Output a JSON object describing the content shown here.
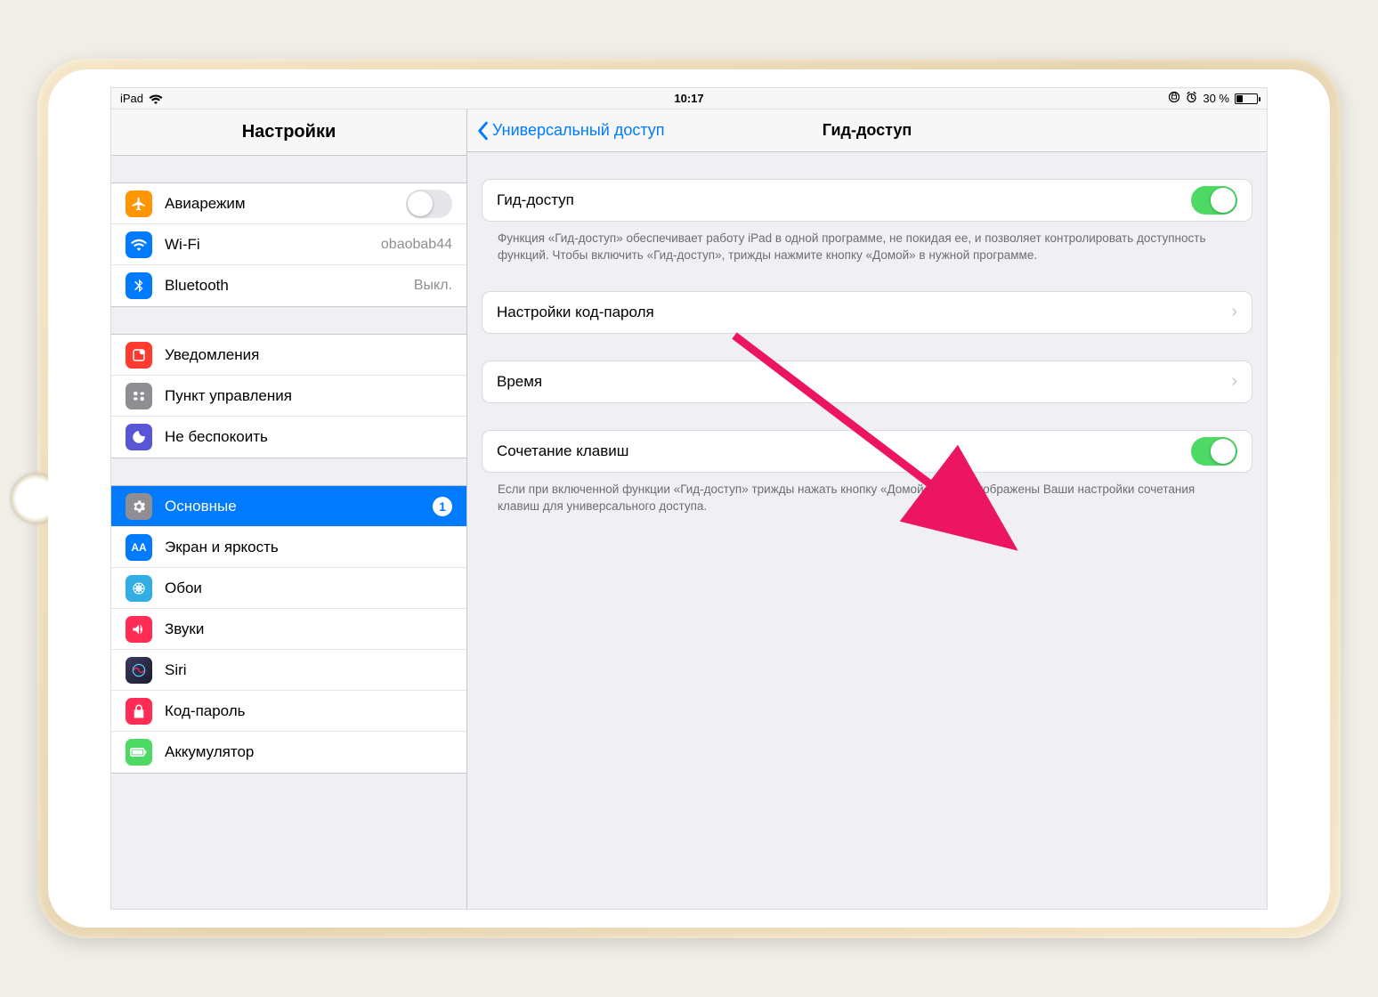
{
  "status": {
    "device": "iPad",
    "time": "10:17",
    "battery_text": "30 %"
  },
  "sidebar": {
    "title": "Настройки",
    "airplane": {
      "label": "Авиарежим",
      "on": false
    },
    "wifi": {
      "label": "Wi-Fi",
      "value": "obaobab44"
    },
    "bluetooth": {
      "label": "Bluetooth",
      "value": "Выкл."
    },
    "notifications": {
      "label": "Уведомления"
    },
    "control_center": {
      "label": "Пункт управления"
    },
    "dnd": {
      "label": "Не беспокоить"
    },
    "general": {
      "label": "Основные",
      "badge": "1"
    },
    "display": {
      "label": "Экран и яркость"
    },
    "wallpaper": {
      "label": "Обои"
    },
    "sounds": {
      "label": "Звуки"
    },
    "siri": {
      "label": "Siri"
    },
    "passcode": {
      "label": "Код-пароль"
    },
    "battery": {
      "label": "Аккумулятор"
    }
  },
  "detail": {
    "back_label": "Универсальный доступ",
    "title": "Гид-доступ",
    "guided_access": {
      "label": "Гид-доступ",
      "on": true
    },
    "guided_access_note": "Функция «Гид-доступ» обеспечивает работу iPad в одной программе, не покидая ее, и позволяет контролировать доступность функций. Чтобы включить «Гид-доступ», трижды нажмите кнопку «Домой» в нужной программе.",
    "passcode_settings": {
      "label": "Настройки код-пароля"
    },
    "time": {
      "label": "Время"
    },
    "shortcut": {
      "label": "Сочетание клавиш",
      "on": true
    },
    "shortcut_note": "Если при включенной функции «Гид-доступ» трижды нажать кнопку «Домой», будут отображены Ваши настройки сочетания клавиш для универсального доступа."
  }
}
